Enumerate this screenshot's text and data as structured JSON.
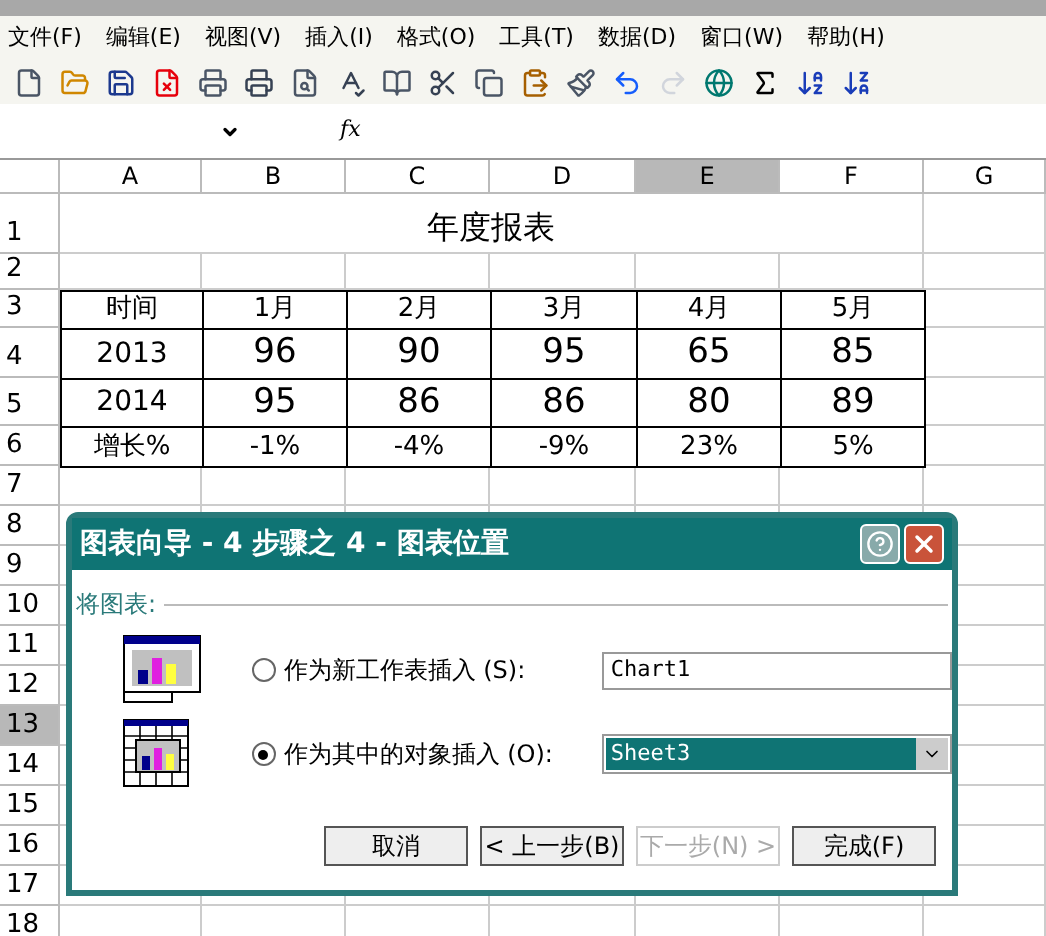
{
  "menu": [
    "文件(F)",
    "编辑(E)",
    "视图(V)",
    "插入(I)",
    "格式(O)",
    "工具(T)",
    "数据(D)",
    "窗口(W)",
    "帮助(H)"
  ],
  "formula_bar": {
    "function_label": "fx"
  },
  "columns": [
    {
      "label": "A",
      "selected": false
    },
    {
      "label": "B",
      "selected": false
    },
    {
      "label": "C",
      "selected": false
    },
    {
      "label": "D",
      "selected": false
    },
    {
      "label": "E",
      "selected": true
    },
    {
      "label": "F",
      "selected": false
    },
    {
      "label": "G",
      "selected": false
    }
  ],
  "rows": [
    {
      "label": "1",
      "selected": false
    },
    {
      "label": "2",
      "selected": false
    },
    {
      "label": "3",
      "selected": false
    },
    {
      "label": "4",
      "selected": false
    },
    {
      "label": "5",
      "selected": false
    },
    {
      "label": "6",
      "selected": false
    },
    {
      "label": "7",
      "selected": false
    },
    {
      "label": "8",
      "selected": false
    },
    {
      "label": "9",
      "selected": false
    },
    {
      "label": "10",
      "selected": false
    },
    {
      "label": "11",
      "selected": false
    },
    {
      "label": "12",
      "selected": false
    },
    {
      "label": "13",
      "selected": true
    },
    {
      "label": "14",
      "selected": false
    },
    {
      "label": "15",
      "selected": false
    },
    {
      "label": "16",
      "selected": false
    },
    {
      "label": "17",
      "selected": false
    },
    {
      "label": "18",
      "selected": false
    }
  ],
  "sheet_title": "年度报表",
  "table": [
    [
      "时间",
      "1月",
      "2月",
      "3月",
      "4月",
      "5月"
    ],
    [
      "2013",
      "96",
      "90",
      "95",
      "65",
      "85"
    ],
    [
      "2014",
      "95",
      "86",
      "86",
      "80",
      "89"
    ],
    [
      "增长%",
      "-1%",
      "-4%",
      "-9%",
      "23%",
      "5%"
    ]
  ],
  "dialog": {
    "title": "图表向导 - 4 步骤之 4 - 图表位置",
    "group_label": "将图表:",
    "options": [
      {
        "kind": "sheet",
        "label": "作为新工作表插入 (S):",
        "value": "Chart1",
        "selected": false
      },
      {
        "kind": "object",
        "label": "作为其中的对象插入 (O):",
        "value": "Sheet3",
        "selected": true
      }
    ],
    "buttons": [
      {
        "label": "取消",
        "disabled": false
      },
      {
        "label": "< 上一步(B)",
        "disabled": false
      },
      {
        "label": "下一步(N) >",
        "disabled": true
      },
      {
        "label": "完成(F)",
        "disabled": false
      }
    ]
  }
}
